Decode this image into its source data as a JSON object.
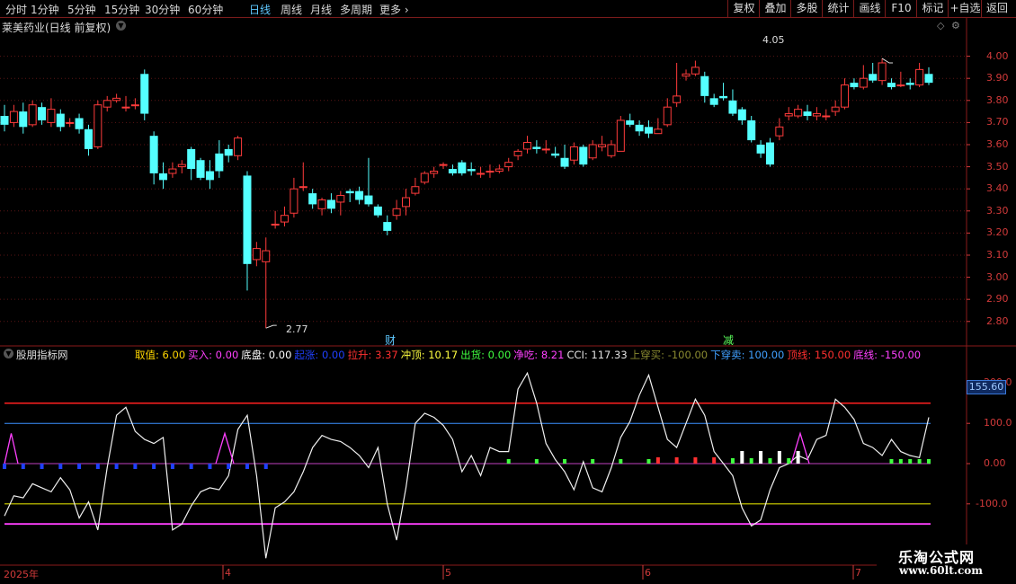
{
  "toolbar": {
    "periods": [
      "分时",
      "1分钟",
      "5分钟",
      "15分钟",
      "30分钟",
      "60分钟",
      "日线",
      "周线",
      "月线",
      "多周期",
      "更多"
    ],
    "active_period": "日线",
    "right_buttons": [
      "复权",
      "叠加",
      "多股",
      "统计",
      "画线",
      "F10",
      "标记",
      "+自选",
      "返回"
    ]
  },
  "stock": {
    "title": "莱美药业(日线 前复权)",
    "high_label": "4.05",
    "low_label": "2.77",
    "marker_cai": "财",
    "marker_jian": "减"
  },
  "price_axis": {
    "ticks": [
      "4.00",
      "3.90",
      "3.80",
      "3.70",
      "3.60",
      "3.50",
      "3.40",
      "3.30",
      "3.20",
      "3.10",
      "3.00",
      "2.90",
      "2.80"
    ],
    "ylim": [
      2.73,
      4.1
    ]
  },
  "indicator": {
    "name": "股朋指标网",
    "params": [
      {
        "label": "取值:",
        "value": "6.00",
        "color": "#ffd700"
      },
      {
        "label": "买入:",
        "value": "0.00",
        "color": "#ff40ff"
      },
      {
        "label": "底盘:",
        "value": "0.00",
        "color": "#ffffff"
      },
      {
        "label": "起涨:",
        "value": "0.00",
        "color": "#2040ff"
      },
      {
        "label": "拉升:",
        "value": "3.37",
        "color": "#ff3030"
      },
      {
        "label": "冲顶:",
        "value": "10.17",
        "color": "#ffff40"
      },
      {
        "label": "出货:",
        "value": "0.00",
        "color": "#40ff40"
      },
      {
        "label": "净吃:",
        "value": "8.21",
        "color": "#ff40ff"
      },
      {
        "label": "CCI:",
        "value": "117.33",
        "color": "#e0e0e0"
      },
      {
        "label": "上穿买:",
        "value": "-100.00",
        "color": "#8a8a30"
      },
      {
        "label": "下穿卖:",
        "value": "100.00",
        "color": "#40a0ff"
      },
      {
        "label": "顶线:",
        "value": "150.00",
        "color": "#ff3030"
      },
      {
        "label": "底线:",
        "value": "-150.00",
        "color": "#ff40ff"
      }
    ],
    "axis_ticks": [
      "200.0",
      "100.0",
      "0.00",
      "-100.0"
    ],
    "current_value": "155.60"
  },
  "dates": {
    "year": "2025年",
    "months": [
      "4",
      "5",
      "6",
      "7"
    ]
  },
  "watermark": {
    "line1": "乐淘公式网",
    "line2": "www.60lt.com"
  },
  "chart_data": {
    "type": "candlestick",
    "candles": [
      [
        3.73,
        3.69,
        3.78,
        3.66
      ],
      [
        3.7,
        3.75,
        3.78,
        3.68
      ],
      [
        3.75,
        3.68,
        3.79,
        3.65
      ],
      [
        3.69,
        3.78,
        3.8,
        3.68
      ],
      [
        3.77,
        3.71,
        3.79,
        3.69
      ],
      [
        3.7,
        3.76,
        3.81,
        3.68
      ],
      [
        3.74,
        3.68,
        3.76,
        3.66
      ],
      [
        3.7,
        3.7,
        3.72,
        3.68
      ],
      [
        3.72,
        3.67,
        3.74,
        3.65
      ],
      [
        3.67,
        3.58,
        3.69,
        3.55
      ],
      [
        3.59,
        3.78,
        3.8,
        3.58
      ],
      [
        3.77,
        3.8,
        3.82,
        3.75
      ],
      [
        3.8,
        3.81,
        3.83,
        3.79
      ],
      [
        3.77,
        3.77,
        3.82,
        3.75
      ],
      [
        3.78,
        3.78,
        3.81,
        3.76
      ],
      [
        3.92,
        3.74,
        3.94,
        3.71
      ],
      [
        3.64,
        3.47,
        3.66,
        3.42
      ],
      [
        3.47,
        3.44,
        3.52,
        3.4
      ],
      [
        3.47,
        3.49,
        3.52,
        3.45
      ],
      [
        3.5,
        3.51,
        3.53,
        3.47
      ],
      [
        3.58,
        3.49,
        3.59,
        3.44
      ],
      [
        3.53,
        3.45,
        3.54,
        3.44
      ],
      [
        3.48,
        3.44,
        3.53,
        3.4
      ],
      [
        3.56,
        3.48,
        3.62,
        3.45
      ],
      [
        3.58,
        3.55,
        3.6,
        3.52
      ],
      [
        3.55,
        3.63,
        3.64,
        3.53
      ],
      [
        3.46,
        3.06,
        3.48,
        2.94
      ],
      [
        3.08,
        3.13,
        3.16,
        3.05
      ],
      [
        3.07,
        3.12,
        3.18,
        2.77
      ],
      [
        3.24,
        3.24,
        3.3,
        3.22
      ],
      [
        3.25,
        3.28,
        3.32,
        3.23
      ],
      [
        3.29,
        3.4,
        3.45,
        3.27
      ],
      [
        3.41,
        3.41,
        3.52,
        3.39
      ],
      [
        3.38,
        3.33,
        3.4,
        3.31
      ],
      [
        3.31,
        3.35,
        3.36,
        3.28
      ],
      [
        3.35,
        3.31,
        3.38,
        3.29
      ],
      [
        3.34,
        3.37,
        3.39,
        3.28
      ],
      [
        3.39,
        3.38,
        3.4,
        3.34
      ],
      [
        3.39,
        3.35,
        3.41,
        3.33
      ],
      [
        3.37,
        3.33,
        3.54,
        3.32
      ],
      [
        3.32,
        3.28,
        3.33,
        3.27
      ],
      [
        3.25,
        3.21,
        3.28,
        3.19
      ],
      [
        3.28,
        3.31,
        3.35,
        3.26
      ],
      [
        3.32,
        3.36,
        3.4,
        3.28
      ],
      [
        3.38,
        3.41,
        3.45,
        3.37
      ],
      [
        3.43,
        3.47,
        3.48,
        3.42
      ],
      [
        3.47,
        3.48,
        3.5,
        3.45
      ],
      [
        3.51,
        3.51,
        3.52,
        3.49
      ],
      [
        3.49,
        3.47,
        3.51,
        3.46
      ],
      [
        3.52,
        3.47,
        3.53,
        3.46
      ],
      [
        3.49,
        3.48,
        3.52,
        3.46
      ],
      [
        3.47,
        3.47,
        3.5,
        3.45
      ],
      [
        3.48,
        3.48,
        3.51,
        3.45
      ],
      [
        3.48,
        3.49,
        3.51,
        3.47
      ],
      [
        3.5,
        3.52,
        3.54,
        3.48
      ],
      [
        3.55,
        3.57,
        3.58,
        3.53
      ],
      [
        3.58,
        3.61,
        3.64,
        3.56
      ],
      [
        3.59,
        3.58,
        3.62,
        3.56
      ],
      [
        3.58,
        3.58,
        3.62,
        3.56
      ],
      [
        3.56,
        3.55,
        3.59,
        3.54
      ],
      [
        3.54,
        3.5,
        3.6,
        3.49
      ],
      [
        3.53,
        3.59,
        3.61,
        3.51
      ],
      [
        3.59,
        3.51,
        3.6,
        3.5
      ],
      [
        3.54,
        3.6,
        3.62,
        3.53
      ],
      [
        3.59,
        3.6,
        3.64,
        3.57
      ],
      [
        3.55,
        3.6,
        3.62,
        3.54
      ],
      [
        3.57,
        3.71,
        3.73,
        3.57
      ],
      [
        3.71,
        3.69,
        3.74,
        3.68
      ],
      [
        3.69,
        3.66,
        3.71,
        3.64
      ],
      [
        3.68,
        3.65,
        3.71,
        3.63
      ],
      [
        3.65,
        3.67,
        3.72,
        3.65
      ],
      [
        3.69,
        3.77,
        3.81,
        3.68
      ],
      [
        3.79,
        3.82,
        3.97,
        3.77
      ],
      [
        3.91,
        3.92,
        3.94,
        3.89
      ],
      [
        3.92,
        3.95,
        3.98,
        3.91
      ],
      [
        3.91,
        3.82,
        3.93,
        3.79
      ],
      [
        3.81,
        3.78,
        3.83,
        3.77
      ],
      [
        3.82,
        3.81,
        3.88,
        3.8
      ],
      [
        3.8,
        3.74,
        3.85,
        3.73
      ],
      [
        3.76,
        3.71,
        3.77,
        3.69
      ],
      [
        3.71,
        3.62,
        3.73,
        3.61
      ],
      [
        3.6,
        3.56,
        3.62,
        3.54
      ],
      [
        3.61,
        3.51,
        3.63,
        3.5
      ],
      [
        3.64,
        3.68,
        3.72,
        3.62
      ],
      [
        3.73,
        3.74,
        3.77,
        3.71
      ],
      [
        3.73,
        3.76,
        3.78,
        3.72
      ],
      [
        3.75,
        3.73,
        3.78,
        3.71
      ],
      [
        3.73,
        3.74,
        3.77,
        3.71
      ],
      [
        3.73,
        3.73,
        3.76,
        3.71
      ],
      [
        3.75,
        3.77,
        3.8,
        3.73
      ],
      [
        3.77,
        3.87,
        3.9,
        3.76
      ],
      [
        3.88,
        3.86,
        3.9,
        3.85
      ],
      [
        3.86,
        3.9,
        3.96,
        3.85
      ],
      [
        3.92,
        3.89,
        3.97,
        3.88
      ],
      [
        3.89,
        3.97,
        3.99,
        3.87
      ],
      [
        3.88,
        3.86,
        3.9,
        3.85
      ],
      [
        3.87,
        3.87,
        3.93,
        3.86
      ],
      [
        3.88,
        3.87,
        3.9,
        3.85
      ],
      [
        3.87,
        3.94,
        3.97,
        3.86
      ],
      [
        3.92,
        3.88,
        3.95,
        3.87
      ]
    ],
    "cci": [
      -130,
      -80,
      -85,
      -50,
      -60,
      -70,
      -35,
      -65,
      -135,
      -95,
      -165,
      -10,
      120,
      140,
      80,
      60,
      50,
      65,
      -165,
      -150,
      -105,
      -70,
      -60,
      -65,
      -30,
      85,
      120,
      -30,
      -235,
      -110,
      -95,
      -70,
      -20,
      40,
      70,
      60,
      55,
      40,
      20,
      -10,
      40,
      -100,
      -190,
      -60,
      100,
      125,
      115,
      95,
      60,
      -20,
      20,
      -30,
      40,
      30,
      30,
      185,
      225,
      150,
      50,
      10,
      -20,
      -65,
      5,
      -60,
      -70,
      -10,
      65,
      105,
      170,
      220,
      140,
      60,
      40,
      100,
      160,
      120,
      30,
      0,
      -30,
      -110,
      -155,
      -140,
      -65,
      -10,
      0,
      20,
      10,
      60,
      70,
      160,
      140,
      110,
      50,
      40,
      20,
      60,
      30,
      20,
      15,
      115
    ],
    "cci_ylim": [
      -250,
      250
    ],
    "lines": {
      "top": 150,
      "upper": 100,
      "lower": -100,
      "bottom": -150
    }
  }
}
